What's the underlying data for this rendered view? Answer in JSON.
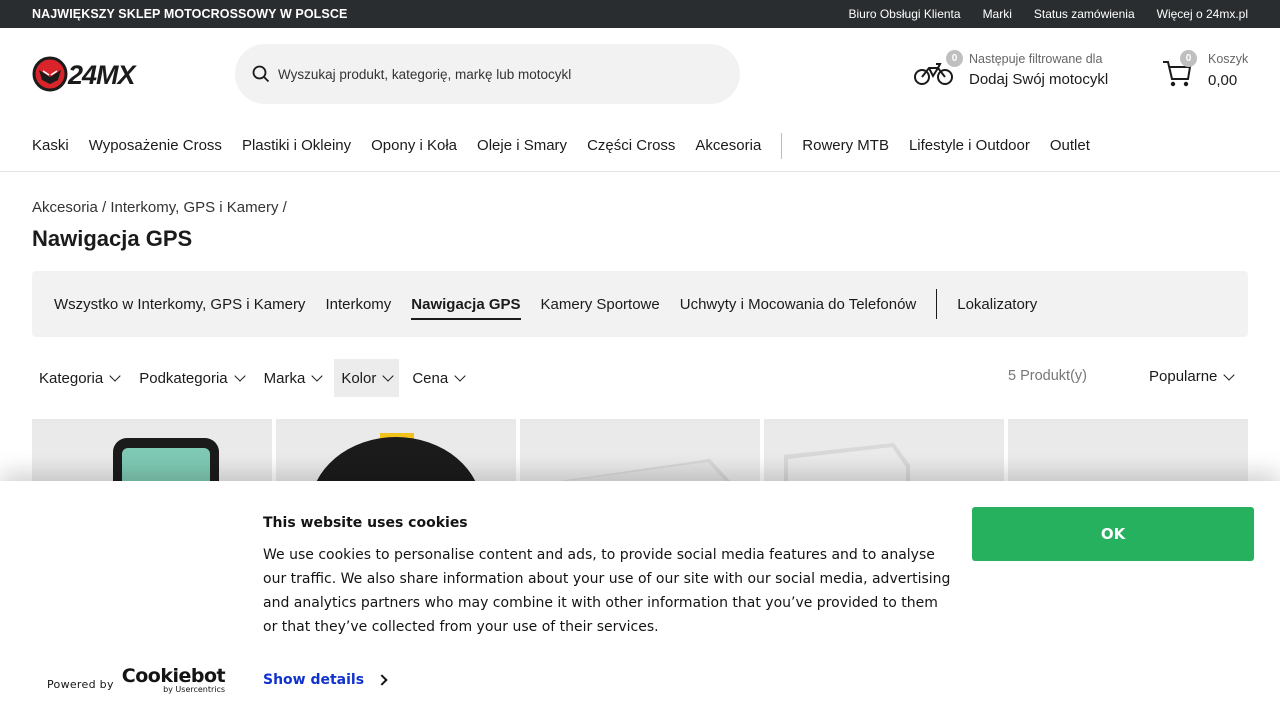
{
  "topbar": {
    "promo": "NAJWIĘKSZY SKLEP MOTOCROSSOWY W POLSCE",
    "links": [
      "Biuro Obsługi Klienta",
      "Marki",
      "Status zamówienia",
      "Więcej o 24mx.pl"
    ]
  },
  "header": {
    "logo_text": "24MX",
    "search_placeholder": "Wyszukaj produkt, kategorię, markę lub motocykl",
    "moto": {
      "badge": "0",
      "small": "Następuje filtrowane dla",
      "big": "Dodaj Swój motocykl"
    },
    "cart": {
      "badge": "0",
      "small": "Koszyk",
      "total": "0,00"
    }
  },
  "mainnav": {
    "left": [
      "Kaski",
      "Wyposażenie Cross",
      "Plastiki i Okleiny",
      "Opony i Koła",
      "Oleje i Smary",
      "Części Cross",
      "Akcesoria"
    ],
    "right": [
      "Rowery MTB",
      "Lifestyle i Outdoor",
      "Outlet"
    ]
  },
  "breadcrumb": [
    "Akcesoria",
    "Interkomy, GPS i Kamery"
  ],
  "page_title": "Nawigacja GPS",
  "subcategories": {
    "items": [
      "Wszystko w Interkomy, GPS i Kamery",
      "Interkomy",
      "Nawigacja GPS",
      "Kamery Sportowe",
      "Uchwyty i Mocowania do Telefonów"
    ],
    "extra": "Lokalizatory"
  },
  "filters": [
    "Kategoria",
    "Podkategoria",
    "Marka",
    "Kolor",
    "Cena"
  ],
  "product_count": "5 Produkt(y)",
  "sort": "Popularne",
  "cookie": {
    "title": "This website uses cookies",
    "text": "We use cookies to personalise content and ads, to provide social media features and to analyse our traffic. We also share information about your use of our site with our social media, advertising and analytics partners who may combine it with other information that you’ve provided to them or that they’ve collected from your use of their services.",
    "ok": "OK",
    "powered_by": "Powered by",
    "brand": "Cookiebot",
    "brand_sub": "by Usercentrics",
    "show_details": "Show details"
  },
  "colors": {
    "topbar": "#2a2d2f",
    "accent_green": "#26b15e",
    "link_blue": "#1032cf",
    "logo_red": "#d8242a"
  }
}
